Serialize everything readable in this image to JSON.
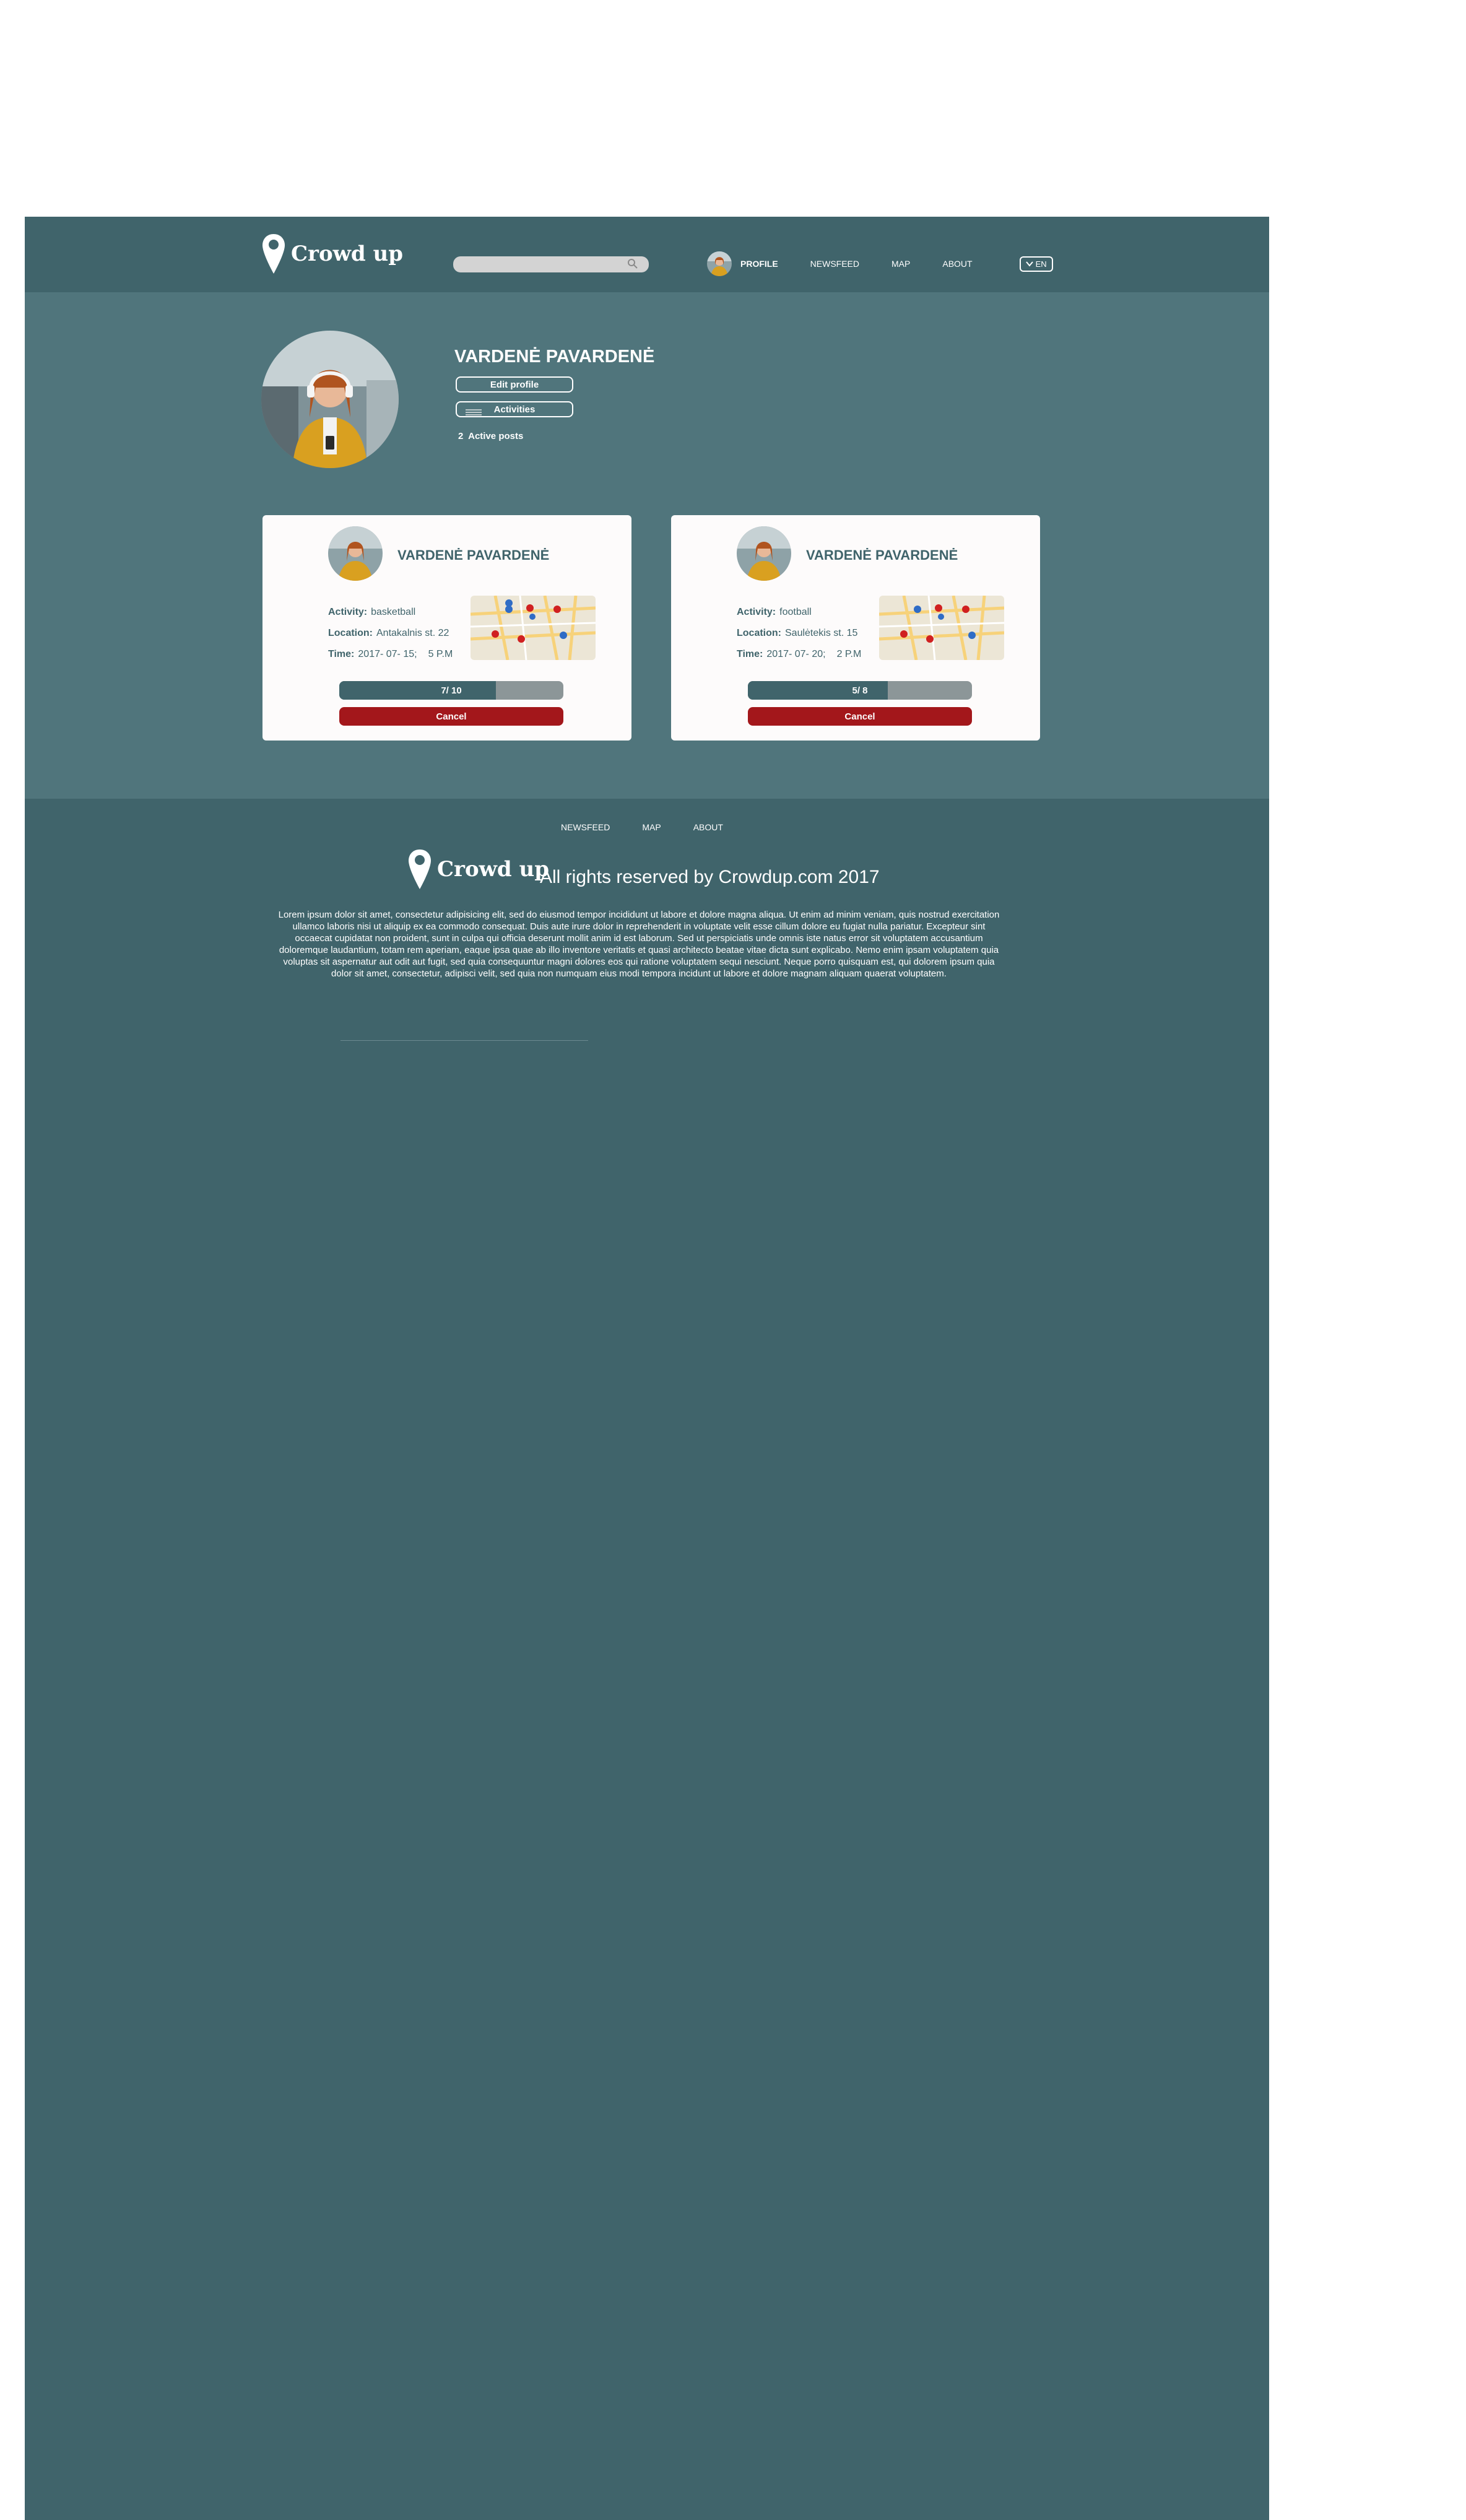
{
  "brand": {
    "name": "Crowd up"
  },
  "header": {
    "search": {
      "placeholder": ""
    },
    "nav": [
      {
        "label": "PROFILE",
        "active": true
      },
      {
        "label": "NEWSFEED"
      },
      {
        "label": "MAP"
      },
      {
        "label": "ABOUT"
      }
    ],
    "language": "EN"
  },
  "profile": {
    "name": "VARDENĖ PAVARDENĖ",
    "edit_label": "Edit profile",
    "activities_label": "Activities",
    "active_posts_count": "2",
    "active_posts_label": "Active posts"
  },
  "cards": [
    {
      "name": "VARDENĖ PAVARDENĖ",
      "activity_label": "Activity:",
      "activity": "basketball",
      "location_label": "Location:",
      "location": "Antakalnis st. 22",
      "time_label": "Time:",
      "date": "2017- 07- 15;",
      "hour": "5 P.M",
      "progress_text": "7/ 10",
      "progress_fraction": 0.7,
      "cancel_label": "Cancel"
    },
    {
      "name": "VARDENĖ PAVARDENĖ",
      "activity_label": "Activity:",
      "activity": "football",
      "location_label": "Location:",
      "location": "Saulėtekis st. 15",
      "time_label": "Time:",
      "date": "2017- 07- 20;",
      "hour": "2 P.M",
      "progress_text": "5/ 8",
      "progress_fraction": 0.625,
      "cancel_label": "Cancel"
    }
  ],
  "footer": {
    "nav": [
      "NEWSFEED",
      "MAP",
      "ABOUT"
    ],
    "rights": "All rights reserved by Crowdup.com 2017",
    "lorem": "Lorem ipsum dolor sit amet, consectetur adipisicing elit, sed do eiusmod tempor incididunt ut labore et dolore magna aliqua. Ut enim ad minim veniam, quis nostrud exercitation ullamco laboris nisi ut aliquip ex ea commodo consequat. Duis aute irure dolor in reprehenderit in voluptate velit esse cillum dolore eu fugiat nulla pariatur. Excepteur sint occaecat cupidatat non proident, sunt in culpa qui officia deserunt mollit anim id est laborum. Sed ut perspiciatis unde omnis iste natus error sit voluptatem accusantium doloremque laudantium, totam rem aperiam, eaque ipsa quae ab illo inventore veritatis et quasi architecto beatae vitae dicta sunt explicabo. Nemo enim ipsam voluptatem quia voluptas sit aspernatur aut odit aut fugit, sed quia consequuntur magni dolores eos qui ratione voluptatem sequi nesciunt. Neque porro quisquam est, qui dolorem ipsum quia dolor sit amet, consectetur, adipisci velit, sed quia non numquam eius modi tempora incidunt ut labore et dolore magnam aliquam quaerat voluptatem."
  },
  "colors": {
    "dark_teal": "#40646b",
    "light_teal": "#50757c",
    "cancel_red": "#a3171b",
    "progress_track": "#8c9698",
    "card_bg": "#fdfbfb"
  },
  "icons": [
    "location-pin-icon",
    "search-icon",
    "chevron-down-icon",
    "menu-icon",
    "map-thumbnail-icon"
  ]
}
